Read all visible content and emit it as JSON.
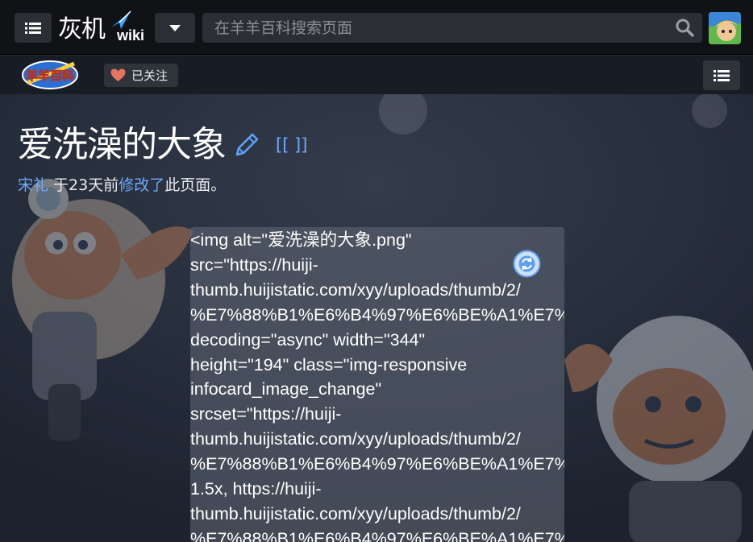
{
  "topbar": {
    "logo_text": "灰机",
    "logo_wiki": "wiki",
    "search_placeholder": "在羊羊百科搜索页面",
    "menu_icon": "list-icon",
    "dropdown_icon": "caret-down-icon",
    "search_icon": "search-icon"
  },
  "subbar": {
    "site_logo_text": "羊羊百科",
    "follow_label": "已关注",
    "follow_icon": "heart-icon",
    "toc_icon": "list-icon"
  },
  "page": {
    "title": "爱洗澡的大象",
    "source_link": "[[ ]]",
    "editor": "宋礼",
    "meta_mid": " 于23天前",
    "meta_link": "修改了",
    "meta_end": "此页面。"
  },
  "infocard": {
    "alt_lines": "<img alt=\"爱洗澡的大象.png\"\nsrc=\"https://huiji-\nthumb.huijistatic.com/xyy/uploads/thumb/2/\n%E7%88%B1%E6%B4%97%E6%BE%A1%E7%\ndecoding=\"async\" width=\"344\"\nheight=\"194\" class=\"img-responsive\ninfocard_image_change\"\nsrcset=\"https://huiji-\nthumb.huijistatic.com/xyy/uploads/thumb/2/\n%E7%88%B1%E6%B4%97%E6%BE%A1%E7%\n1.5x, https://huiji-\nthumb.huijistatic.com/xyy/uploads/thumb/2/\n%E7%88%B1%E6%B4%97%E6%BE%A1%E7%"
  },
  "colors": {
    "topbar_bg": "#101216",
    "link": "#6fa9ff",
    "heart": "#e8735f",
    "page_bg": "#252c3a"
  }
}
